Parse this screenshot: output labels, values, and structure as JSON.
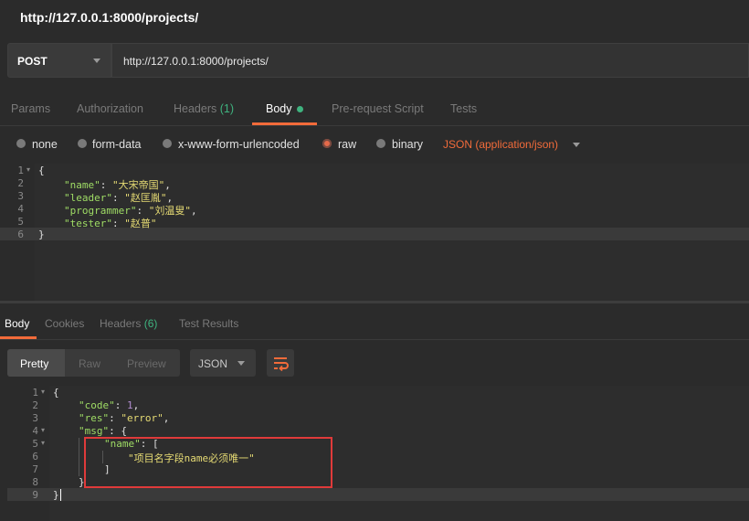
{
  "window": {
    "title": "http://127.0.0.1:8000/projects/"
  },
  "request": {
    "method": "POST",
    "url": "http://127.0.0.1:8000/projects/"
  },
  "tabs": {
    "params": "Params",
    "authorization": "Authorization",
    "headers": "Headers",
    "headers_count": "(1)",
    "body": "Body",
    "prerequest": "Pre-request Script",
    "tests": "Tests"
  },
  "body_options": {
    "none": "none",
    "form_data": "form-data",
    "urlencoded": "x-www-form-urlencoded",
    "raw": "raw",
    "binary": "binary",
    "content_type": "JSON (application/json)"
  },
  "request_body": {
    "line_numbers": [
      "1",
      "2",
      "3",
      "4",
      "5",
      "6"
    ],
    "open": "{",
    "close": "}",
    "fields": [
      {
        "key": "\"name\"",
        "value": "\"大宋帝国\"",
        "sep": ","
      },
      {
        "key": "\"leader\"",
        "value": "\"赵匡胤\"",
        "sep": ","
      },
      {
        "key": "\"programmer\"",
        "value": "\"刘温叟\"",
        "sep": ","
      },
      {
        "key": "\"tester\"",
        "value": "\"赵普\"",
        "sep": ""
      }
    ]
  },
  "response_tabs": {
    "body": "Body",
    "cookies": "Cookies",
    "headers": "Headers",
    "headers_count": "(6)",
    "test_results": "Test Results"
  },
  "response_view": {
    "pretty": "Pretty",
    "raw": "Raw",
    "preview": "Preview",
    "format": "JSON"
  },
  "response_body": {
    "line_numbers": [
      "1",
      "2",
      "3",
      "4",
      "5",
      "6",
      "7",
      "8",
      "9"
    ],
    "open": "{",
    "code_key": "\"code\"",
    "code_value": "1",
    "res_key": "\"res\"",
    "res_value": "\"error\"",
    "msg_key": "\"msg\"",
    "name_key": "\"name\"",
    "name_message": "\"项目名字段name必须唯一\"",
    "array_open": "[",
    "array_close": "]",
    "obj_open": "{",
    "obj_close": "}",
    "close": "}"
  },
  "colors": {
    "accent": "#f26b3a",
    "active_dot": "#3fb37f",
    "highlight_box": "#e03a3a"
  }
}
